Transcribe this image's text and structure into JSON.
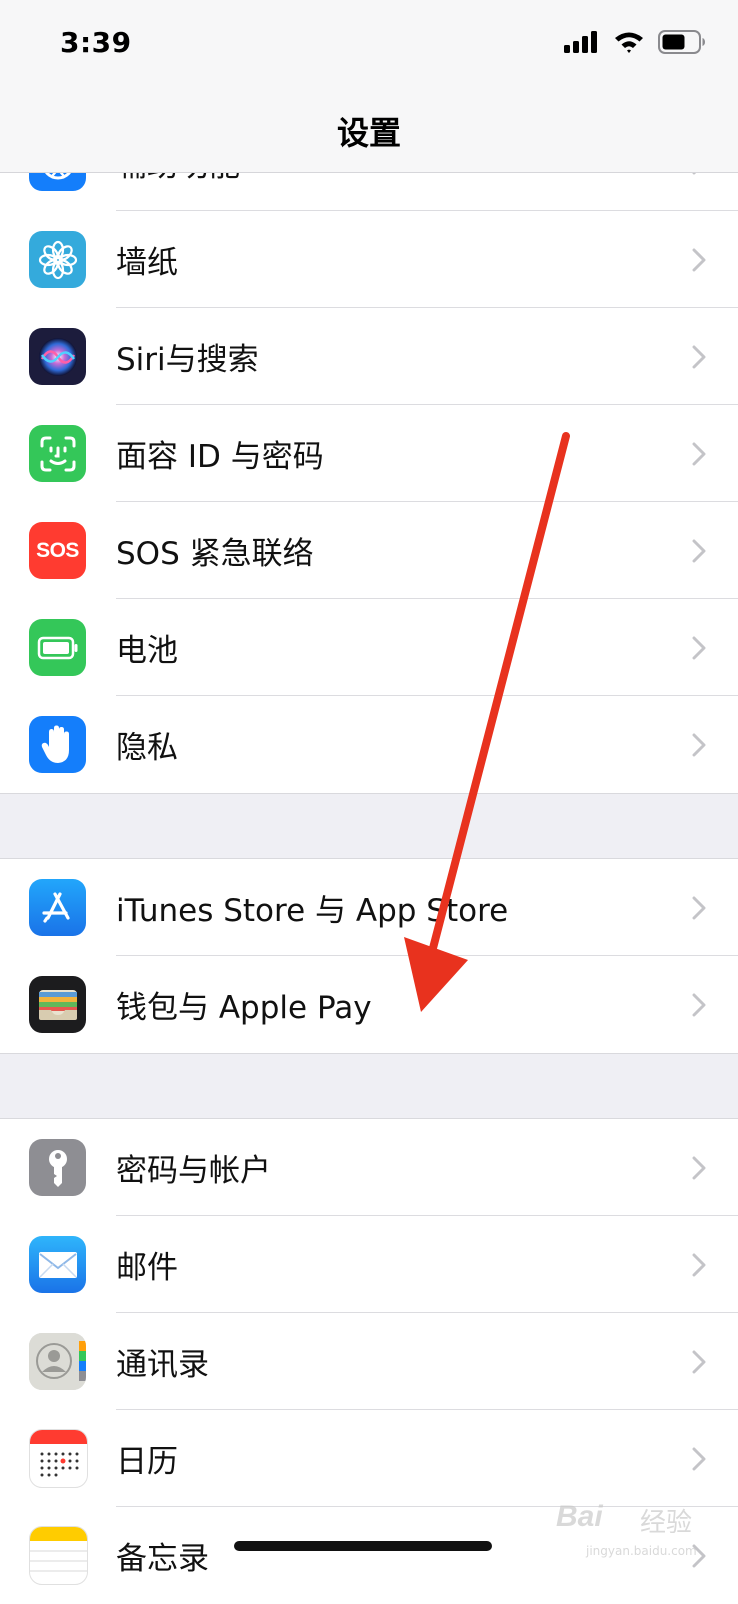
{
  "status_bar": {
    "time": "3:39",
    "icons": [
      "cellular-signal-icon",
      "wifi-icon",
      "battery-icon"
    ]
  },
  "nav": {
    "title": "设置"
  },
  "groups": [
    {
      "items": [
        {
          "label": "辅助功能",
          "icon": "accessibility-icon",
          "color": "#147efb"
        },
        {
          "label": "墙纸",
          "icon": "wallpaper-flower-icon",
          "color": "#34aadc"
        },
        {
          "label": "Siri与搜索",
          "icon": "siri-icon",
          "color": "#1c1c3c"
        },
        {
          "label": "面容 ID 与密码",
          "icon": "face-id-icon",
          "color": "#34c759"
        },
        {
          "label": "SOS 紧急联络",
          "icon": "sos-icon",
          "color": "#ff3b30"
        },
        {
          "label": "电池",
          "icon": "battery-setting-icon",
          "color": "#34c759"
        },
        {
          "label": "隐私",
          "icon": "privacy-hand-icon",
          "color": "#147efb"
        }
      ]
    },
    {
      "items": [
        {
          "label": "iTunes Store 与 App Store",
          "icon": "app-store-icon",
          "color": "#1e8efc"
        },
        {
          "label": "钱包与 Apple Pay",
          "icon": "wallet-icon",
          "color": "#1c1c1e"
        }
      ]
    },
    {
      "items": [
        {
          "label": "密码与帐户",
          "icon": "key-icon",
          "color": "#8e8e93"
        },
        {
          "label": "邮件",
          "icon": "mail-icon",
          "color": "#1e8efc"
        },
        {
          "label": "通讯录",
          "icon": "contacts-icon",
          "color": "#d8d8d4"
        },
        {
          "label": "日历",
          "icon": "calendar-icon",
          "color": "#ffffff"
        },
        {
          "label": "备忘录",
          "icon": "notes-icon",
          "color": "#ffffff"
        }
      ]
    }
  ],
  "annotation": {
    "arrow_color": "#e8321e"
  },
  "watermark": {
    "brand": "Bai",
    "cn": "经验",
    "url": "jingyan.baidu.com"
  }
}
